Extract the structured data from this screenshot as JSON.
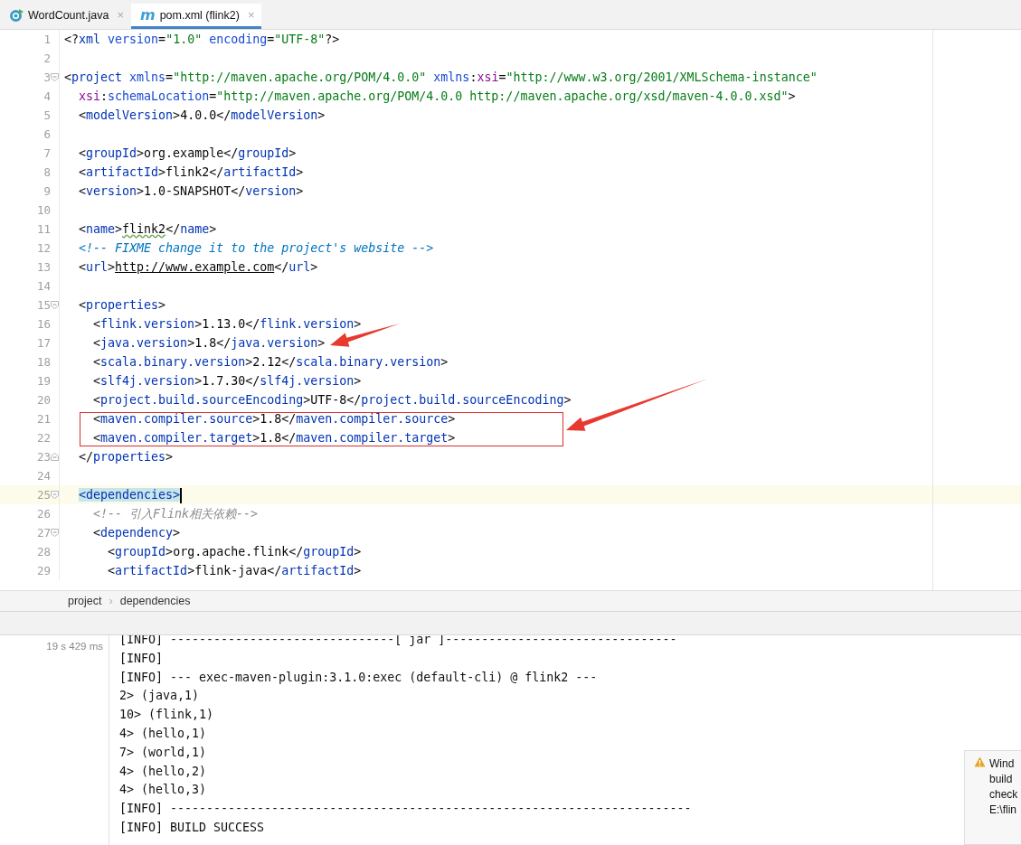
{
  "tabs": [
    {
      "kind": "class",
      "label": "WordCount.java",
      "close": "×",
      "selected": false
    },
    {
      "kind": "maven",
      "icon_text": "m",
      "label": "pom.xml (flink2)",
      "close": "×",
      "selected": true
    }
  ],
  "editor": {
    "lines": [
      {
        "n": "1",
        "tokens": [
          {
            "kind": "p",
            "text": "<?"
          },
          {
            "kind": "tag",
            "text": "xml"
          },
          {
            "kind": "attr",
            "text": " version"
          },
          {
            "kind": "p",
            "text": "="
          },
          {
            "kind": "str",
            "text": "\"1.0\""
          },
          {
            "kind": "attr",
            "text": " encoding"
          },
          {
            "kind": "p",
            "text": "="
          },
          {
            "kind": "str",
            "text": "\"UTF-8\""
          },
          {
            "kind": "p",
            "text": "?>"
          }
        ]
      },
      {
        "n": "2"
      },
      {
        "n": "3",
        "fold_start": true,
        "tokens": [
          {
            "kind": "p",
            "text": "<"
          },
          {
            "kind": "tag",
            "text": "project"
          },
          {
            "kind": "attr",
            "text": " xmlns"
          },
          {
            "kind": "p",
            "text": "="
          },
          {
            "kind": "str",
            "text": "\"http://maven.apache.org/POM/4.0.0\""
          },
          {
            "kind": "attr",
            "text": " xmlns"
          },
          {
            "kind": "p",
            "text": ":"
          },
          {
            "kind": "ns",
            "text": "xsi"
          },
          {
            "kind": "p",
            "text": "="
          },
          {
            "kind": "str",
            "text": "\"http://www.w3.org/2001/XMLSchema-instance\""
          }
        ]
      },
      {
        "n": "4",
        "tokens": [
          {
            "kind": "ns",
            "text": "  xsi"
          },
          {
            "kind": "p",
            "text": ":"
          },
          {
            "kind": "attr",
            "text": "schemaLocation"
          },
          {
            "kind": "p",
            "text": "="
          },
          {
            "kind": "str",
            "text": "\"http://maven.apache.org/POM/4.0.0 http://maven.apache.org/xsd/maven-4.0.0.xsd\""
          },
          {
            "kind": "p",
            "text": ">"
          }
        ]
      },
      {
        "n": "5",
        "tokens": [
          {
            "kind": "p",
            "text": "  <"
          },
          {
            "kind": "tag",
            "text": "modelVersion"
          },
          {
            "kind": "p",
            "text": ">"
          },
          {
            "kind": "text",
            "text": "4.0.0"
          },
          {
            "kind": "p",
            "text": "</"
          },
          {
            "kind": "tag",
            "text": "modelVersion"
          },
          {
            "kind": "p",
            "text": ">"
          }
        ]
      },
      {
        "n": "6"
      },
      {
        "n": "7",
        "tokens": [
          {
            "kind": "p",
            "text": "  <"
          },
          {
            "kind": "tag",
            "text": "groupId"
          },
          {
            "kind": "p",
            "text": ">"
          },
          {
            "kind": "text",
            "text": "org.example"
          },
          {
            "kind": "p",
            "text": "</"
          },
          {
            "kind": "tag",
            "text": "groupId"
          },
          {
            "kind": "p",
            "text": ">"
          }
        ]
      },
      {
        "n": "8",
        "tokens": [
          {
            "kind": "p",
            "text": "  <"
          },
          {
            "kind": "tag",
            "text": "artifactId"
          },
          {
            "kind": "p",
            "text": ">"
          },
          {
            "kind": "text",
            "text": "flink2"
          },
          {
            "kind": "p",
            "text": "</"
          },
          {
            "kind": "tag",
            "text": "artifactId"
          },
          {
            "kind": "p",
            "text": ">"
          }
        ]
      },
      {
        "n": "9",
        "tokens": [
          {
            "kind": "p",
            "text": "  <"
          },
          {
            "kind": "tag",
            "text": "version"
          },
          {
            "kind": "p",
            "text": ">"
          },
          {
            "kind": "text",
            "text": "1.0-SNAPSHOT"
          },
          {
            "kind": "p",
            "text": "</"
          },
          {
            "kind": "tag",
            "text": "version"
          },
          {
            "kind": "p",
            "text": ">"
          }
        ]
      },
      {
        "n": "10"
      },
      {
        "n": "11",
        "tokens": [
          {
            "kind": "p",
            "text": "  <"
          },
          {
            "kind": "tag",
            "text": "name"
          },
          {
            "kind": "p",
            "text": ">"
          },
          {
            "kind": "typo",
            "text": "flink2"
          },
          {
            "kind": "p",
            "text": "</"
          },
          {
            "kind": "tag",
            "text": "name"
          },
          {
            "kind": "p",
            "text": ">"
          }
        ]
      },
      {
        "n": "12",
        "tokens": [
          {
            "kind": "todo",
            "text": "  <!-- FIXME change it to the project's website -->"
          }
        ]
      },
      {
        "n": "13",
        "tokens": [
          {
            "kind": "p",
            "text": "  <"
          },
          {
            "kind": "tag",
            "text": "url"
          },
          {
            "kind": "p",
            "text": ">"
          },
          {
            "kind": "url",
            "text": "http://www.example.com"
          },
          {
            "kind": "p",
            "text": "</"
          },
          {
            "kind": "tag",
            "text": "url"
          },
          {
            "kind": "p",
            "text": ">"
          }
        ]
      },
      {
        "n": "14"
      },
      {
        "n": "15",
        "fold_start": true,
        "tokens": [
          {
            "kind": "p",
            "text": "  <"
          },
          {
            "kind": "tag",
            "text": "properties"
          },
          {
            "kind": "p",
            "text": ">"
          }
        ]
      },
      {
        "n": "16",
        "tokens": [
          {
            "kind": "p",
            "text": "    <"
          },
          {
            "kind": "tag",
            "text": "flink.version"
          },
          {
            "kind": "p",
            "text": ">"
          },
          {
            "kind": "text",
            "text": "1.13.0"
          },
          {
            "kind": "p",
            "text": "</"
          },
          {
            "kind": "tag",
            "text": "flink.version"
          },
          {
            "kind": "p",
            "text": ">"
          }
        ]
      },
      {
        "n": "17",
        "tokens": [
          {
            "kind": "p",
            "text": "    <"
          },
          {
            "kind": "tag",
            "text": "java.version"
          },
          {
            "kind": "p",
            "text": ">"
          },
          {
            "kind": "text",
            "text": "1.8"
          },
          {
            "kind": "p",
            "text": "</"
          },
          {
            "kind": "tag",
            "text": "java.version"
          },
          {
            "kind": "p",
            "text": ">"
          }
        ]
      },
      {
        "n": "18",
        "tokens": [
          {
            "kind": "p",
            "text": "    <"
          },
          {
            "kind": "tag",
            "text": "scala.binary.version"
          },
          {
            "kind": "p",
            "text": ">"
          },
          {
            "kind": "text",
            "text": "2.12"
          },
          {
            "kind": "p",
            "text": "</"
          },
          {
            "kind": "tag",
            "text": "scala.binary.version"
          },
          {
            "kind": "p",
            "text": ">"
          }
        ]
      },
      {
        "n": "19",
        "tokens": [
          {
            "kind": "p",
            "text": "    <"
          },
          {
            "kind": "tag",
            "text": "slf4j.version"
          },
          {
            "kind": "p",
            "text": ">"
          },
          {
            "kind": "text",
            "text": "1.7.30"
          },
          {
            "kind": "p",
            "text": "</"
          },
          {
            "kind": "tag",
            "text": "slf4j.version"
          },
          {
            "kind": "p",
            "text": ">"
          }
        ]
      },
      {
        "n": "20",
        "tokens": [
          {
            "kind": "p",
            "text": "    <"
          },
          {
            "kind": "tag",
            "text": "project.build.sourceEncoding"
          },
          {
            "kind": "p",
            "text": ">"
          },
          {
            "kind": "text",
            "text": "UTF-8"
          },
          {
            "kind": "p",
            "text": "</"
          },
          {
            "kind": "tag",
            "text": "project.build.sourceEncoding"
          },
          {
            "kind": "p",
            "text": ">"
          }
        ]
      },
      {
        "n": "21",
        "tokens": [
          {
            "kind": "p",
            "text": "    <"
          },
          {
            "kind": "tag",
            "text": "maven.compiler.source"
          },
          {
            "kind": "p",
            "text": ">"
          },
          {
            "kind": "text",
            "text": "1.8"
          },
          {
            "kind": "p",
            "text": "</"
          },
          {
            "kind": "tag",
            "text": "maven.compiler.source"
          },
          {
            "kind": "p",
            "text": ">"
          }
        ]
      },
      {
        "n": "22",
        "tokens": [
          {
            "kind": "p",
            "text": "    <"
          },
          {
            "kind": "tag",
            "text": "maven.compiler.target"
          },
          {
            "kind": "p",
            "text": ">"
          },
          {
            "kind": "text",
            "text": "1.8"
          },
          {
            "kind": "p",
            "text": "</"
          },
          {
            "kind": "tag",
            "text": "maven.compiler.target"
          },
          {
            "kind": "p",
            "text": ">"
          }
        ]
      },
      {
        "n": "23",
        "fold_end": true,
        "tokens": [
          {
            "kind": "p",
            "text": "  </"
          },
          {
            "kind": "tag",
            "text": "properties"
          },
          {
            "kind": "p",
            "text": ">"
          }
        ]
      },
      {
        "n": "24"
      },
      {
        "n": "25",
        "fold_start": true,
        "current": true,
        "tokens": [
          {
            "kind": "match",
            "text": "  <dependencies>"
          }
        ]
      },
      {
        "n": "26",
        "tokens": [
          {
            "kind": "comment",
            "text": "    <!-- 引入Flink相关依赖-->"
          }
        ]
      },
      {
        "n": "27",
        "fold_start": true,
        "tokens": [
          {
            "kind": "p",
            "text": "    <"
          },
          {
            "kind": "tag",
            "text": "dependency"
          },
          {
            "kind": "p",
            "text": ">"
          }
        ]
      },
      {
        "n": "28",
        "tokens": [
          {
            "kind": "p",
            "text": "      <"
          },
          {
            "kind": "tag",
            "text": "groupId"
          },
          {
            "kind": "p",
            "text": ">"
          },
          {
            "kind": "text",
            "text": "org.apache.flink"
          },
          {
            "kind": "p",
            "text": "</"
          },
          {
            "kind": "tag",
            "text": "groupId"
          },
          {
            "kind": "p",
            "text": ">"
          }
        ]
      },
      {
        "n": "29",
        "tokens": [
          {
            "kind": "p",
            "text": "      <"
          },
          {
            "kind": "tag",
            "text": "artifactId"
          },
          {
            "kind": "p",
            "text": ">"
          },
          {
            "kind": "text",
            "text": "flink-java"
          },
          {
            "kind": "p",
            "text": "</"
          },
          {
            "kind": "tag",
            "text": "artifactId"
          },
          {
            "kind": "p",
            "text": ">"
          }
        ]
      }
    ]
  },
  "breadcrumb": [
    {
      "label": "project"
    },
    {
      "label": "dependencies"
    }
  ],
  "breadcrumb_separator": "›",
  "console": {
    "duration": "19 s 429 ms",
    "lines": [
      "[INFO] -------------------------------[ jar ]--------------------------------",
      "[INFO]",
      "[INFO] --- exec-maven-plugin:3.1.0:exec (default-cli) @ flink2 ---",
      "2> (java,1)",
      "10> (flink,1)",
      "4> (hello,1)",
      "7> (world,1)",
      "4> (hello,2)",
      "4> (hello,3)",
      "[INFO] ------------------------------------------------------------------------",
      "[INFO] BUILD SUCCESS"
    ]
  },
  "notification": {
    "lines": [
      "Wind",
      "build",
      "check",
      "E:\\flin"
    ]
  }
}
